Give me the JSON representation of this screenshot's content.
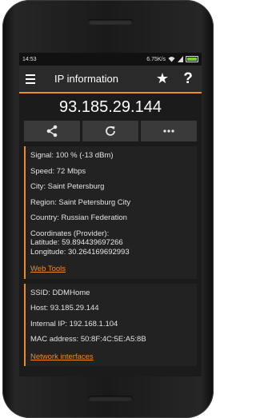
{
  "status": {
    "time": "14:53",
    "speed": "6.75K/s"
  },
  "appbar": {
    "title": "IP information"
  },
  "ip": "93.185.29.144",
  "card1": {
    "signal": "Signal: 100 % (-13 dBm)",
    "speed": "Speed: 72 Mbps",
    "city": "City: Saint Petersburg",
    "region": "Region: Saint Petersburg City",
    "country": "Country: Russian Federation",
    "coords_title": "Coordinates (Provider):",
    "latitude": "Latitude: 59.894439697266",
    "longitude": "Longitude: 30.264169692993",
    "link": "Web Tools"
  },
  "card2": {
    "ssid": "SSID: DDMHome",
    "host": "Host: 93.185.29.144",
    "internal_ip": "Internal IP: 192.168.1.104",
    "mac": "MAC address: 50:8F:4C:5E:A5:8B",
    "link": "Network interfaces"
  },
  "colors": {
    "accent": "#f08a24",
    "background": "#1b1b1b",
    "appbar": "#2a2a2a"
  },
  "icons": [
    "menu-icon",
    "star-icon",
    "help-icon",
    "share-icon",
    "refresh-icon",
    "more-icon"
  ]
}
